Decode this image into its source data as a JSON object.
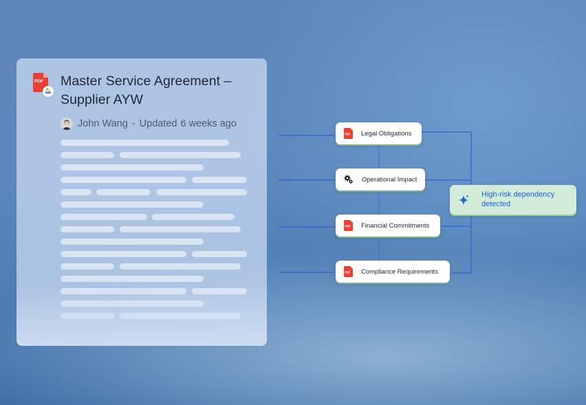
{
  "document": {
    "title": "Master Service Agreement – Supplier AYW",
    "author": "John Wang",
    "separator": "-",
    "updated_label": "Updated",
    "updated_time": "6 weeks ago",
    "icons": [
      "pdf-icon",
      "google-drive-icon",
      "avatar"
    ]
  },
  "categories": [
    {
      "label": "Legal Obligations",
      "icon": "pdf-icon"
    },
    {
      "label": "Operational Impact",
      "icon": "gear-icon"
    },
    {
      "label": "Financial Commitments",
      "icon": "pdf-icon"
    },
    {
      "label": "Compliance Requirements",
      "icon": "pdf-icon"
    }
  ],
  "alert": {
    "icon": "sparkle-icon",
    "line1": "High-risk dependency",
    "line2": "detected"
  },
  "colors": {
    "link_line": "#2a62d6",
    "alert_text": "#1a5fd8",
    "alert_bg": "#d3ecd9",
    "pdf_red": "#e94235"
  }
}
